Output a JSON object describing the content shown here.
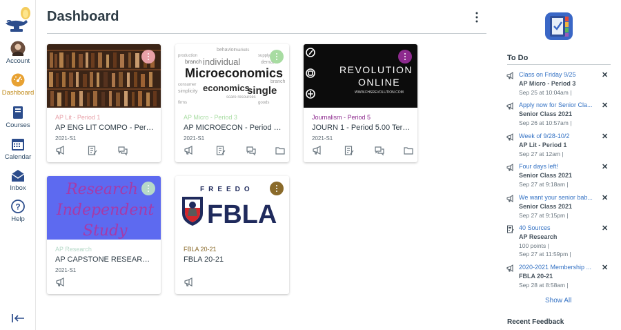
{
  "nav": {
    "items": [
      {
        "label": "Account",
        "icon": "account-avatar-icon"
      },
      {
        "label": "Dashboard",
        "icon": "dashboard-icon"
      },
      {
        "label": "Courses",
        "icon": "courses-icon"
      },
      {
        "label": "Calendar",
        "icon": "calendar-icon"
      },
      {
        "label": "Inbox",
        "icon": "inbox-icon"
      },
      {
        "label": "Help",
        "icon": "help-icon"
      }
    ],
    "active_color": "#c08a1a",
    "text_color": "#2d4a66"
  },
  "header": {
    "title": "Dashboard"
  },
  "cards": [
    {
      "subtitle": "AP Lit - Period 1",
      "name": "AP ENG LIT COMPO - Perio...",
      "term": "2021-S1",
      "color": "#e8a0a8",
      "hero_text": ""
    },
    {
      "subtitle": "AP Micro - Period 3",
      "name": "AP MICROECON - Period 3....",
      "term": "2021-S1",
      "color": "#a8dca2",
      "hero_text": "Microeconomics"
    },
    {
      "subtitle": "Journalism - Period 5",
      "name": "JOURN 1 - Period 5.00 Term...",
      "term": "2021-S1",
      "color": "#8d2a8e",
      "hero_text": "REVOLUTION ONLINE",
      "hero_small": "WWW.FHSREVOLUTION.COM"
    },
    {
      "subtitle": "AP Research",
      "name": "AP CAPSTONE RESEARCH ...",
      "term": "2021-S1",
      "color": "#b6d9c8",
      "hero_text": "Research Independent Study"
    },
    {
      "subtitle": "FBLA 20-21",
      "name": "FBLA 20-21",
      "term": "",
      "color": "#8a6a2a",
      "hero_text": "FBLA",
      "hero_small": "FREEDO"
    }
  ],
  "todo": {
    "heading": "To Do",
    "items": [
      {
        "title": "Class on Friday 9/25",
        "course": "AP Micro - Period 3",
        "date": "Sep 25 at 10:04am  |",
        "icon": "announcement-icon"
      },
      {
        "title": "Apply now for Senior Cla...",
        "course": "Senior Class 2021",
        "date": "Sep 26 at 10:57am  |",
        "icon": "announcement-icon"
      },
      {
        "title": "Week of 9/28-10/2",
        "course": "AP Lit - Period 1",
        "date": "Sep 27 at 12am  |",
        "icon": "announcement-icon"
      },
      {
        "title": "Four days left!",
        "course": "Senior Class 2021",
        "date": "Sep 27 at 9:18am  |",
        "icon": "announcement-icon"
      },
      {
        "title": "We want your senior bab...",
        "course": "Senior Class 2021",
        "date": "Sep 27 at 9:15pm  |",
        "icon": "announcement-icon"
      },
      {
        "title": "40 Sources",
        "course": "AP Research",
        "points": "100 points  |",
        "date": "Sep 27 at 11:59pm  |",
        "icon": "assignment-icon"
      },
      {
        "title": "2020-2021 Membership ...",
        "course": "FBLA 20-21",
        "date": "Sep 28 at 8:58am  |",
        "icon": "announcement-icon"
      }
    ],
    "show_all": "Show All"
  },
  "recent_feedback": "Recent Feedback"
}
